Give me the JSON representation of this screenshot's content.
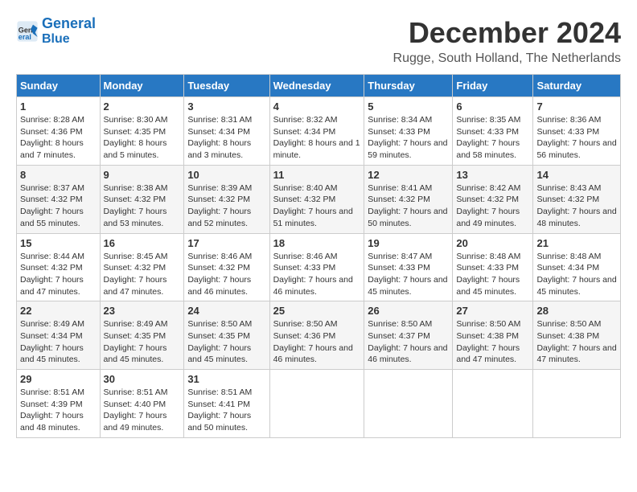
{
  "header": {
    "logo_line1": "General",
    "logo_line2": "Blue",
    "title": "December 2024",
    "subtitle": "Rugge, South Holland, The Netherlands"
  },
  "columns": [
    "Sunday",
    "Monday",
    "Tuesday",
    "Wednesday",
    "Thursday",
    "Friday",
    "Saturday"
  ],
  "weeks": [
    [
      {
        "day": "1",
        "sunrise": "8:28 AM",
        "sunset": "4:36 PM",
        "daylight": "8 hours and 7 minutes."
      },
      {
        "day": "2",
        "sunrise": "8:30 AM",
        "sunset": "4:35 PM",
        "daylight": "8 hours and 5 minutes."
      },
      {
        "day": "3",
        "sunrise": "8:31 AM",
        "sunset": "4:34 PM",
        "daylight": "8 hours and 3 minutes."
      },
      {
        "day": "4",
        "sunrise": "8:32 AM",
        "sunset": "4:34 PM",
        "daylight": "8 hours and 1 minute."
      },
      {
        "day": "5",
        "sunrise": "8:34 AM",
        "sunset": "4:33 PM",
        "daylight": "7 hours and 59 minutes."
      },
      {
        "day": "6",
        "sunrise": "8:35 AM",
        "sunset": "4:33 PM",
        "daylight": "7 hours and 58 minutes."
      },
      {
        "day": "7",
        "sunrise": "8:36 AM",
        "sunset": "4:33 PM",
        "daylight": "7 hours and 56 minutes."
      }
    ],
    [
      {
        "day": "8",
        "sunrise": "8:37 AM",
        "sunset": "4:32 PM",
        "daylight": "7 hours and 55 minutes."
      },
      {
        "day": "9",
        "sunrise": "8:38 AM",
        "sunset": "4:32 PM",
        "daylight": "7 hours and 53 minutes."
      },
      {
        "day": "10",
        "sunrise": "8:39 AM",
        "sunset": "4:32 PM",
        "daylight": "7 hours and 52 minutes."
      },
      {
        "day": "11",
        "sunrise": "8:40 AM",
        "sunset": "4:32 PM",
        "daylight": "7 hours and 51 minutes."
      },
      {
        "day": "12",
        "sunrise": "8:41 AM",
        "sunset": "4:32 PM",
        "daylight": "7 hours and 50 minutes."
      },
      {
        "day": "13",
        "sunrise": "8:42 AM",
        "sunset": "4:32 PM",
        "daylight": "7 hours and 49 minutes."
      },
      {
        "day": "14",
        "sunrise": "8:43 AM",
        "sunset": "4:32 PM",
        "daylight": "7 hours and 48 minutes."
      }
    ],
    [
      {
        "day": "15",
        "sunrise": "8:44 AM",
        "sunset": "4:32 PM",
        "daylight": "7 hours and 47 minutes."
      },
      {
        "day": "16",
        "sunrise": "8:45 AM",
        "sunset": "4:32 PM",
        "daylight": "7 hours and 47 minutes."
      },
      {
        "day": "17",
        "sunrise": "8:46 AM",
        "sunset": "4:32 PM",
        "daylight": "7 hours and 46 minutes."
      },
      {
        "day": "18",
        "sunrise": "8:46 AM",
        "sunset": "4:33 PM",
        "daylight": "7 hours and 46 minutes."
      },
      {
        "day": "19",
        "sunrise": "8:47 AM",
        "sunset": "4:33 PM",
        "daylight": "7 hours and 45 minutes."
      },
      {
        "day": "20",
        "sunrise": "8:48 AM",
        "sunset": "4:33 PM",
        "daylight": "7 hours and 45 minutes."
      },
      {
        "day": "21",
        "sunrise": "8:48 AM",
        "sunset": "4:34 PM",
        "daylight": "7 hours and 45 minutes."
      }
    ],
    [
      {
        "day": "22",
        "sunrise": "8:49 AM",
        "sunset": "4:34 PM",
        "daylight": "7 hours and 45 minutes."
      },
      {
        "day": "23",
        "sunrise": "8:49 AM",
        "sunset": "4:35 PM",
        "daylight": "7 hours and 45 minutes."
      },
      {
        "day": "24",
        "sunrise": "8:50 AM",
        "sunset": "4:35 PM",
        "daylight": "7 hours and 45 minutes."
      },
      {
        "day": "25",
        "sunrise": "8:50 AM",
        "sunset": "4:36 PM",
        "daylight": "7 hours and 46 minutes."
      },
      {
        "day": "26",
        "sunrise": "8:50 AM",
        "sunset": "4:37 PM",
        "daylight": "7 hours and 46 minutes."
      },
      {
        "day": "27",
        "sunrise": "8:50 AM",
        "sunset": "4:38 PM",
        "daylight": "7 hours and 47 minutes."
      },
      {
        "day": "28",
        "sunrise": "8:50 AM",
        "sunset": "4:38 PM",
        "daylight": "7 hours and 47 minutes."
      }
    ],
    [
      {
        "day": "29",
        "sunrise": "8:51 AM",
        "sunset": "4:39 PM",
        "daylight": "7 hours and 48 minutes."
      },
      {
        "day": "30",
        "sunrise": "8:51 AM",
        "sunset": "4:40 PM",
        "daylight": "7 hours and 49 minutes."
      },
      {
        "day": "31",
        "sunrise": "8:51 AM",
        "sunset": "4:41 PM",
        "daylight": "7 hours and 50 minutes."
      },
      null,
      null,
      null,
      null
    ]
  ],
  "labels": {
    "sunrise": "Sunrise:",
    "sunset": "Sunset:",
    "daylight": "Daylight:"
  },
  "colors": {
    "header_bg": "#2878c3",
    "header_text": "#ffffff",
    "row_even": "#f5f5f5",
    "row_odd": "#ffffff"
  }
}
